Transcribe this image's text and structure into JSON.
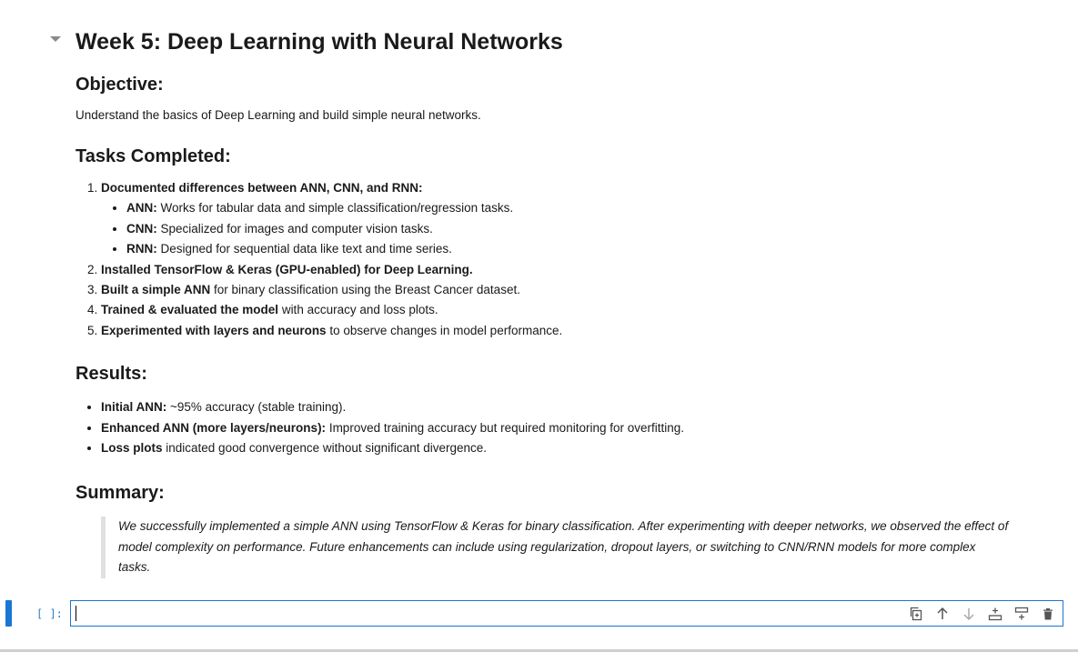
{
  "notebook": {
    "title": "Week 5: Deep Learning with Neural Networks",
    "objective": {
      "heading": "Objective:",
      "text": "Understand the basics of Deep Learning and build simple neural networks."
    },
    "tasks": {
      "heading": "Tasks Completed:",
      "items": [
        {
          "bold": "Documented differences between ANN, CNN, and RNN:",
          "rest": ""
        },
        {
          "bold": "Installed TensorFlow & Keras (GPU-enabled) for Deep Learning.",
          "rest": ""
        },
        {
          "bold": "Built a simple ANN",
          "rest": " for binary classification using the Breast Cancer dataset."
        },
        {
          "bold": "Trained & evaluated the model",
          "rest": " with accuracy and loss plots."
        },
        {
          "bold": "Experimented with layers and neurons",
          "rest": " to observe changes in model performance."
        }
      ],
      "subitems": [
        {
          "bold": "ANN:",
          "rest": " Works for tabular data and simple classification/regression tasks."
        },
        {
          "bold": "CNN:",
          "rest": " Specialized for images and computer vision tasks."
        },
        {
          "bold": "RNN:",
          "rest": " Designed for sequential data like text and time series."
        }
      ]
    },
    "results": {
      "heading": "Results:",
      "items": [
        {
          "bold": "Initial ANN:",
          "rest": " ~95% accuracy (stable training)."
        },
        {
          "bold": "Enhanced ANN (more layers/neurons):",
          "rest": " Improved training accuracy but required monitoring for overfitting."
        },
        {
          "bold": "Loss plots",
          "rest": " indicated good convergence without significant divergence."
        }
      ]
    },
    "summary": {
      "heading": "Summary:",
      "text": "We successfully implemented a simple ANN using TensorFlow & Keras for binary classification. After experimenting with deeper networks, we observed the effect of model complexity on performance. Future enhancements can include using regularization, dropout layers, or switching to CNN/RNN models for more complex tasks."
    }
  },
  "code_cell": {
    "prompt": "[ ]:",
    "value": "",
    "toolbar_icons": [
      "duplicate-icon",
      "move-up-icon",
      "move-down-icon",
      "insert-above-icon",
      "insert-below-icon",
      "delete-icon"
    ]
  },
  "colors": {
    "accent": "#1976d2",
    "prompt": "#307fc1",
    "quote_border": "#e0e0e0"
  }
}
